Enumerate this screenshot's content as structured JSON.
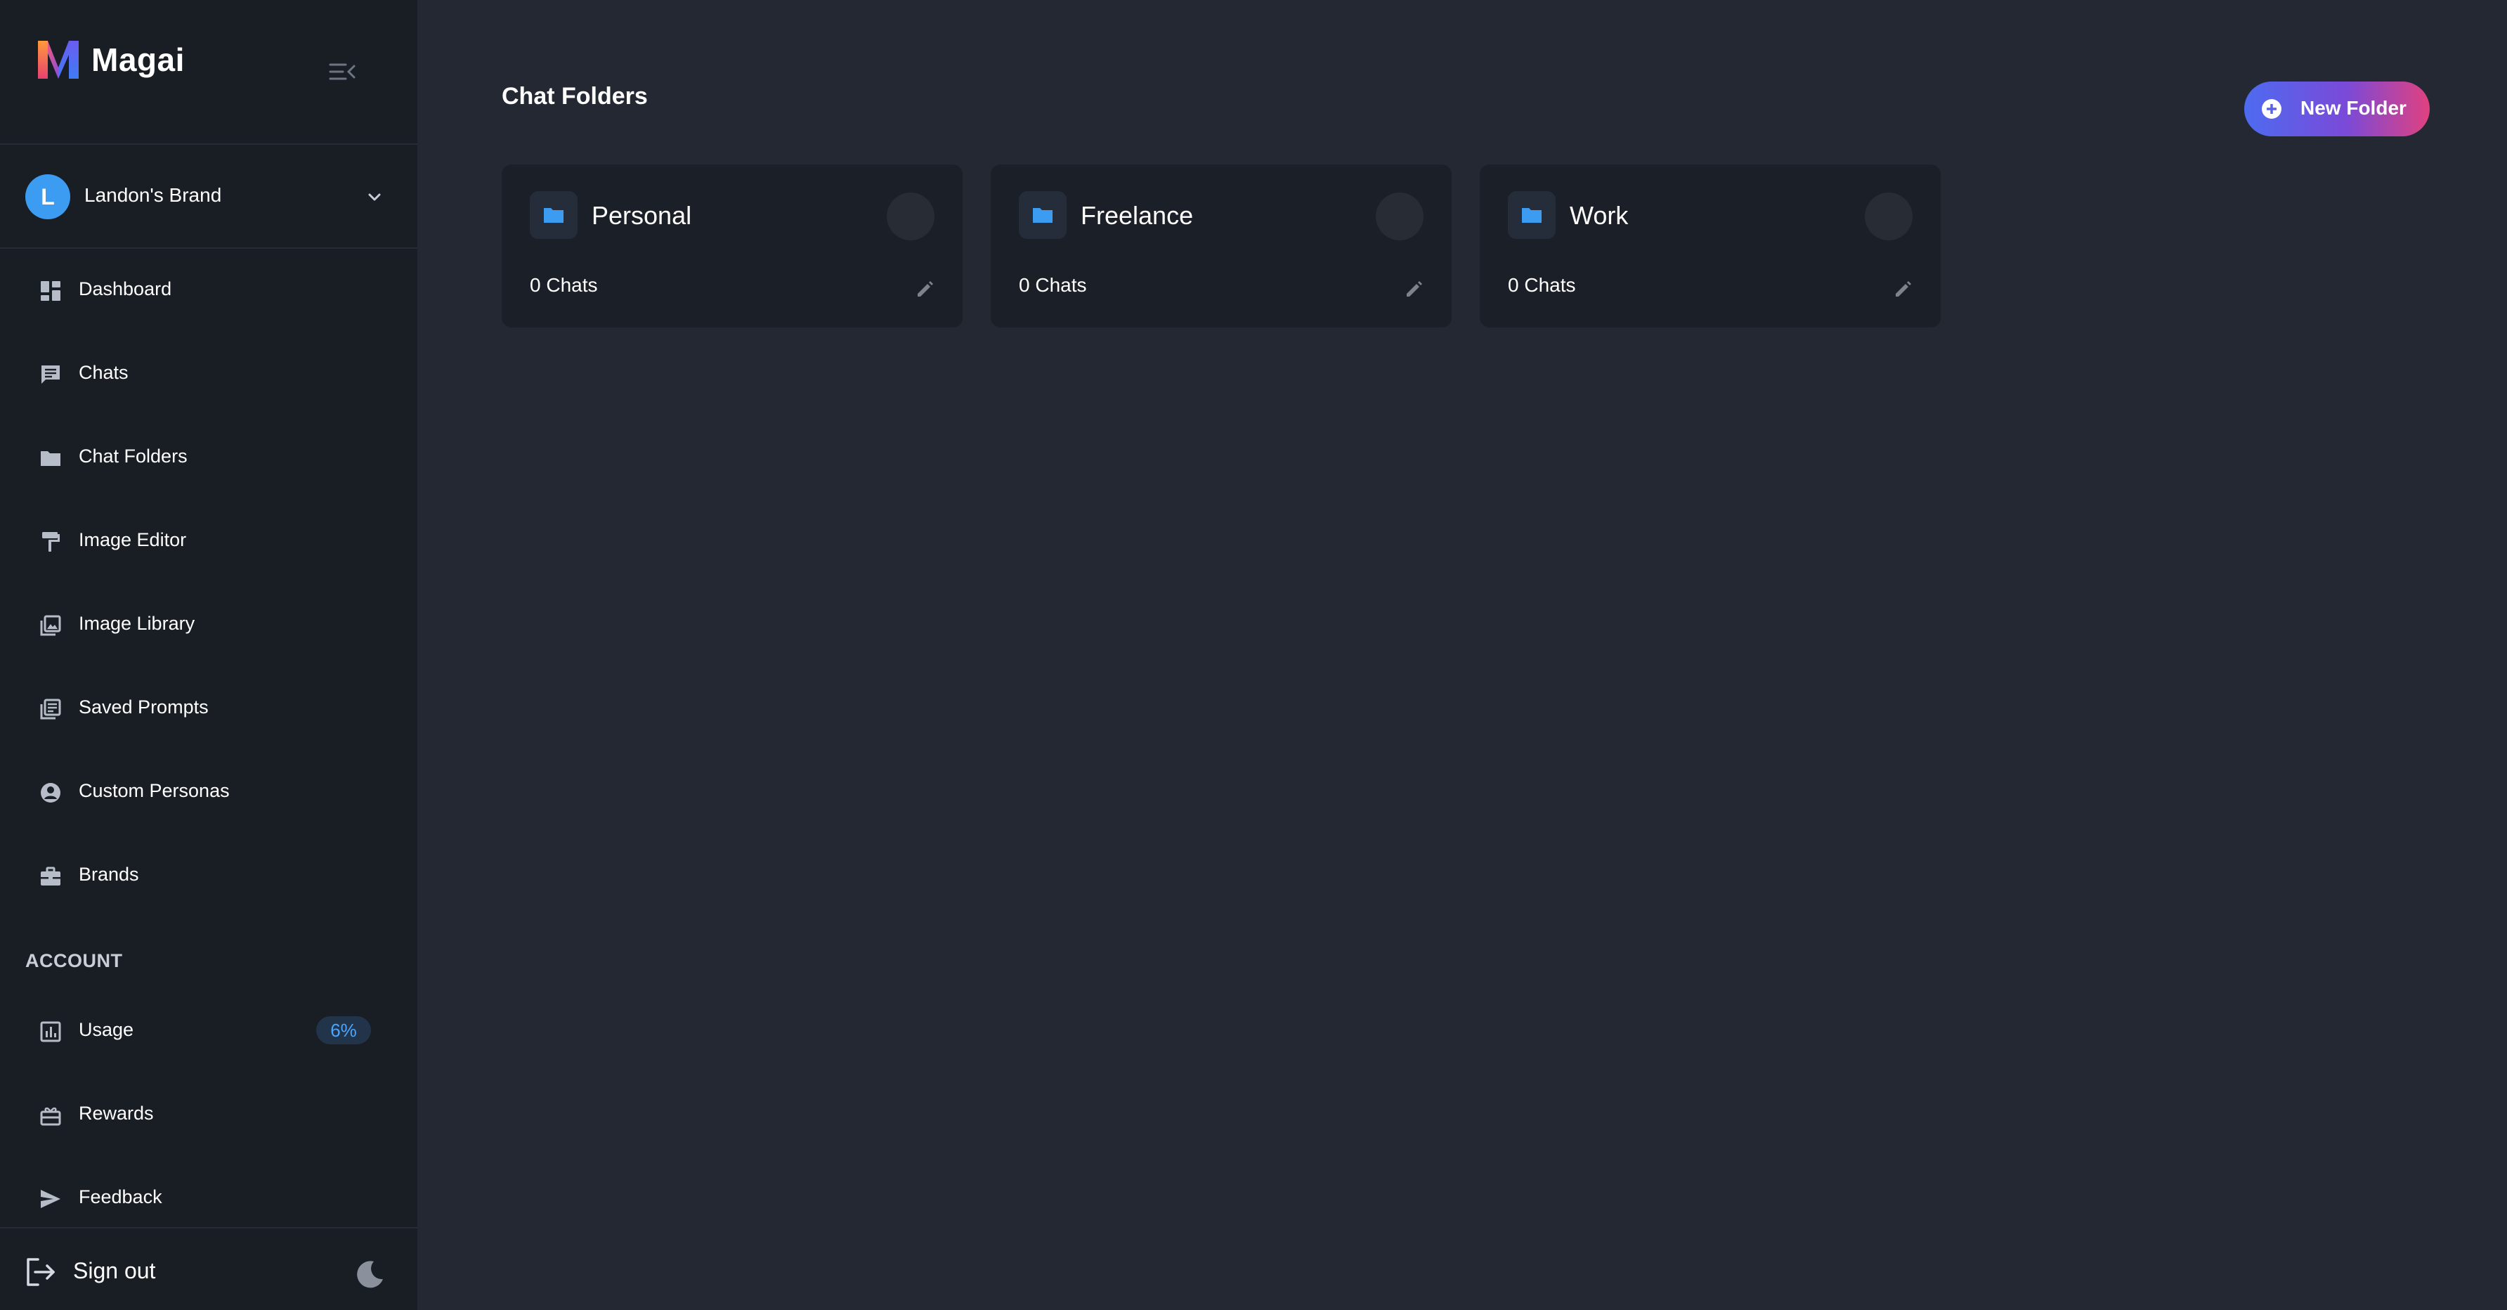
{
  "app": {
    "name": "Magai"
  },
  "sidebar": {
    "brand": {
      "initial": "L",
      "name": "Landon's Brand"
    },
    "items": [
      {
        "label": "Dashboard",
        "icon": "dashboard-icon"
      },
      {
        "label": "Chats",
        "icon": "chat-icon"
      },
      {
        "label": "Chat Folders",
        "icon": "folder-icon"
      },
      {
        "label": "Image Editor",
        "icon": "paint-roller-icon"
      },
      {
        "label": "Image Library",
        "icon": "image-library-icon"
      },
      {
        "label": "Saved Prompts",
        "icon": "saved-prompts-icon"
      },
      {
        "label": "Custom Personas",
        "icon": "persona-icon"
      },
      {
        "label": "Brands",
        "icon": "briefcase-icon"
      }
    ],
    "account_section_label": "ACCOUNT",
    "account_items": [
      {
        "label": "Usage",
        "icon": "bar-chart-icon",
        "badge": "6%"
      },
      {
        "label": "Rewards",
        "icon": "gift-icon"
      },
      {
        "label": "Feedback",
        "icon": "send-icon"
      }
    ],
    "sign_out_label": "Sign out"
  },
  "main": {
    "title": "Chat Folders",
    "new_folder_label": "New Folder",
    "folders": [
      {
        "name": "Personal",
        "count": "0 Chats"
      },
      {
        "name": "Freelance",
        "count": "0 Chats"
      },
      {
        "name": "Work",
        "count": "0 Chats"
      }
    ]
  },
  "colors": {
    "sidebar_bg": "#191d24",
    "main_bg": "#232833",
    "card_bg": "#1b1f27",
    "accent_blue": "#3b9cf2",
    "button_gradient_start": "#4d6bf0",
    "button_gradient_end": "#e0417f"
  }
}
